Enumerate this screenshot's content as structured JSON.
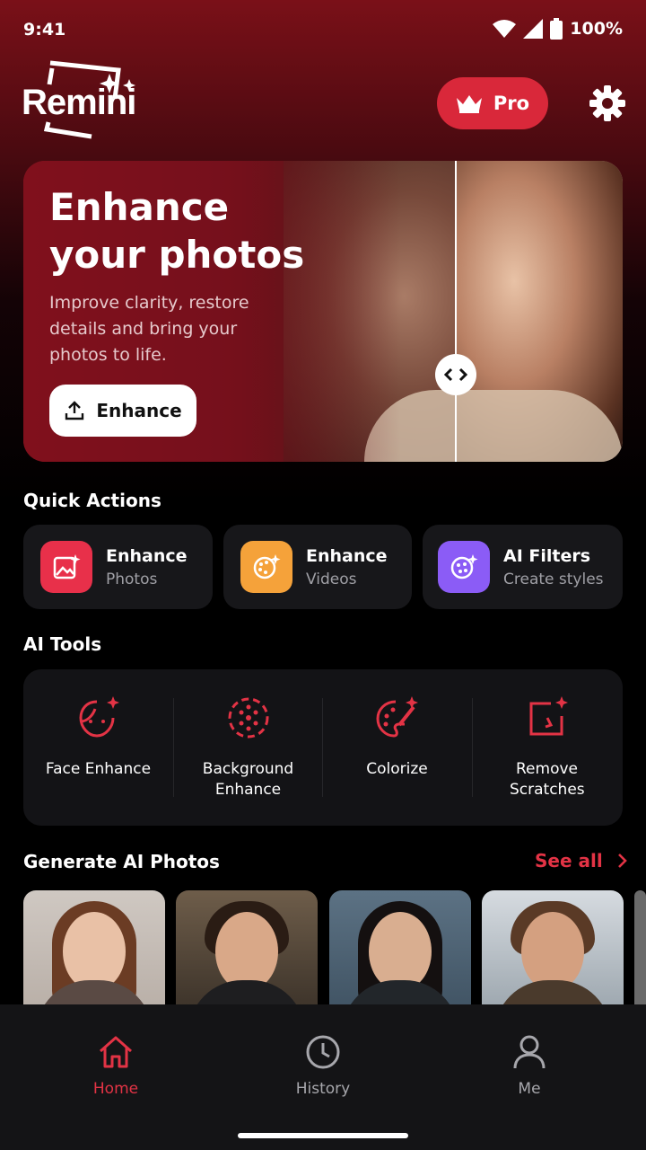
{
  "status": {
    "time": "9:41",
    "battery": "100%"
  },
  "header": {
    "logo_text": "Remini",
    "pro_label": "Pro"
  },
  "hero": {
    "title_line1": "Enhance",
    "title_line2": "your photos",
    "description": "Improve clarity, restore details and bring your photos to life.",
    "button_label": "Enhance"
  },
  "quick_actions": {
    "title": "Quick Actions",
    "items": [
      {
        "title": "Enhance",
        "subtitle": "Photos",
        "icon": "image-sparkle-icon",
        "color": "#e8304a"
      },
      {
        "title": "Enhance",
        "subtitle": "Videos",
        "icon": "palette-sparkle-icon",
        "color": "#f5a23a"
      },
      {
        "title": "AI Filters",
        "subtitle": "Create styles",
        "icon": "globe-sparkle-icon",
        "color": "#8b5cf6"
      }
    ]
  },
  "ai_tools": {
    "title": "AI Tools",
    "items": [
      {
        "label": "Face Enhance",
        "icon": "face-sparkle-icon"
      },
      {
        "label": "Background Enhance",
        "icon": "background-dots-icon"
      },
      {
        "label": "Colorize",
        "icon": "palette-brush-icon"
      },
      {
        "label": "Remove Scratches",
        "icon": "frame-sparkle-icon"
      }
    ]
  },
  "generate": {
    "title": "Generate AI Photos",
    "see_all": "See all"
  },
  "nav": {
    "items": [
      {
        "label": "Home",
        "icon": "home-icon",
        "active": true
      },
      {
        "label": "History",
        "icon": "clock-icon",
        "active": false
      },
      {
        "label": "Me",
        "icon": "person-icon",
        "active": false
      }
    ]
  },
  "colors": {
    "accent": "#e33345",
    "brand_red": "#d9283a"
  }
}
